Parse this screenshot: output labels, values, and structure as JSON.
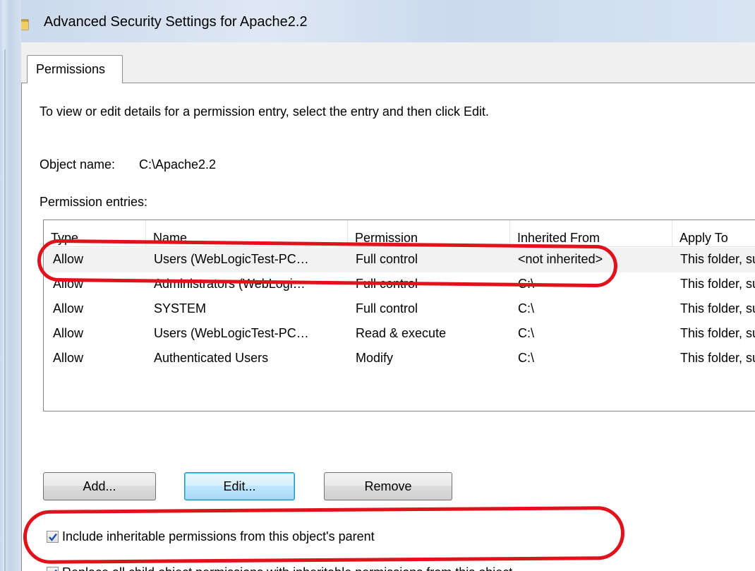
{
  "window": {
    "title": "Advanced Security Settings for Apache2.2",
    "icon": "folder-icon"
  },
  "tabs": [
    {
      "label": "Permissions",
      "active": true
    }
  ],
  "page": {
    "intro": "To view or edit details for a permission entry, select the entry and then click Edit.",
    "object_name_label": "Object name:",
    "object_name_value": "C:\\Apache2.2",
    "entries_label": "Permission entries:"
  },
  "table": {
    "columns": [
      "Type",
      "Name",
      "Permission",
      "Inherited From",
      "Apply To"
    ],
    "rows": [
      {
        "type": "Allow",
        "name": "Users (WebLogicTest-PC…",
        "permission": "Full control",
        "inherited": "<not inherited>",
        "apply": "This folder, su"
      },
      {
        "type": "Allow",
        "name": "Administrators (WebLogi…",
        "permission": "Full control",
        "inherited": "C:\\",
        "apply": "This folder, su"
      },
      {
        "type": "Allow",
        "name": "SYSTEM",
        "permission": "Full control",
        "inherited": "C:\\",
        "apply": "This folder, su"
      },
      {
        "type": "Allow",
        "name": "Users (WebLogicTest-PC…",
        "permission": "Read & execute",
        "inherited": "C:\\",
        "apply": "This folder, su"
      },
      {
        "type": "Allow",
        "name": "Authenticated Users",
        "permission": "Modify",
        "inherited": "C:\\",
        "apply": "This folder, su"
      }
    ]
  },
  "buttons": {
    "add": "Add...",
    "edit": "Edit...",
    "remove": "Remove"
  },
  "checkboxes": {
    "inherit": {
      "label": "Include inheritable permissions from this object's parent",
      "checked": true
    },
    "replace": {
      "label": "Replace all child object permissions with inheritable permissions from this object",
      "checked": true
    }
  },
  "colors": {
    "annotation": "#e0121c",
    "check": "#1e4fa8",
    "default_button_border": "#3c7fb1"
  }
}
